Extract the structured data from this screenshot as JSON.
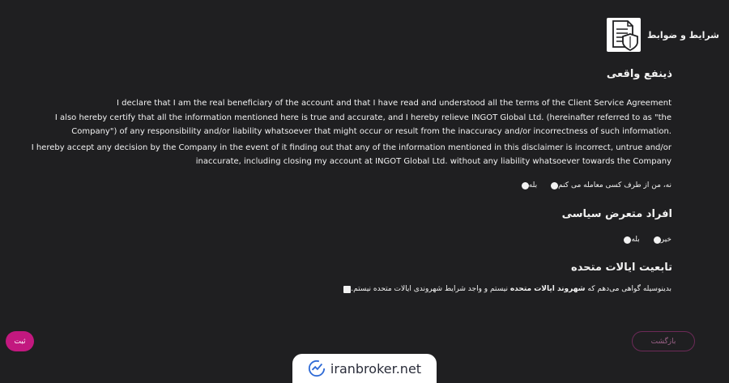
{
  "header": {
    "title": "شرایط و ضوابط",
    "icon": "document-shield-icon"
  },
  "sections": {
    "beneficiary": {
      "title": "ذینفع واقعی",
      "paragraphs": [
        "I declare that I am the real beneficiary of the account and that I have read and understood all the terms of the Client Service Agreement",
        "I also hereby certify that all the information mentioned here is true and accurate, and I hereby relieve INGOT Global Ltd. (hereinafter referred to as \"the Company\") of any responsibility and/or liability whatsoever that might occur or result from the inaccuracy and/or incorrectness of such information.",
        "I hereby accept any decision by the Company in the event of it finding out that any of the information mentioned in this disclaimer is incorrect, untrue and/or inaccurate, including closing my account at INGOT Global Ltd. without any liability whatsoever towards the Company"
      ],
      "options": [
        "بله",
        "نه، من از طرف کسی معامله می کنم"
      ]
    },
    "pep": {
      "title": "افراد متعرض سیاسی",
      "options": [
        "بله",
        "خیر"
      ]
    },
    "us_citizenship": {
      "title": "تابعیت ایالات متحده",
      "checkbox_pre": "بدینوسیله گواهی می‌دهم که",
      "checkbox_bold": "شهروند ایالات متحده",
      "checkbox_post": "نیستم و واجد شرایط شهروندی ایالات متحده نیستم."
    }
  },
  "buttons": {
    "back": "بازگشت",
    "submit": "ثبت"
  },
  "watermark": {
    "text": "iranbroker.net"
  },
  "colors": {
    "background": "#1f1f21",
    "accent": "#c2187f",
    "back_border": "#6d2a58"
  }
}
